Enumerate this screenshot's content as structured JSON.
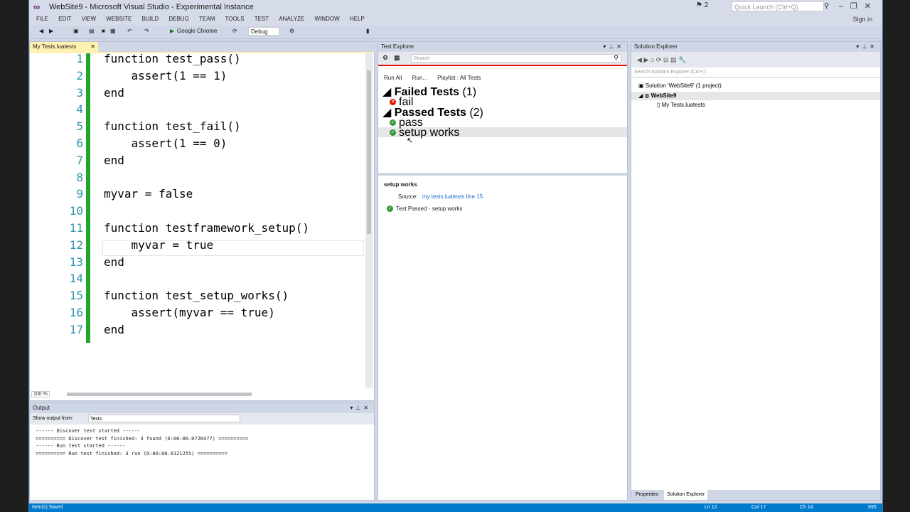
{
  "window": {
    "title": "WebSite9 - Microsoft Visual Studio - Experimental Instance",
    "quick_launch_placeholder": "Quick Launch (Ctrl+Q)",
    "notification_count": "2",
    "sign_in": "Sign in"
  },
  "menu": [
    "FILE",
    "EDIT",
    "VIEW",
    "WEBSITE",
    "BUILD",
    "DEBUG",
    "TEAM",
    "TOOLS",
    "TEST",
    "ANALYZE",
    "WINDOW",
    "HELP"
  ],
  "toolbar": {
    "run_target": "Google Chrome",
    "config": "Debug"
  },
  "editor": {
    "tab": "My Tests.luatests",
    "zoom": "100 %",
    "lines": [
      {
        "n": "1",
        "t": "function test_pass()"
      },
      {
        "n": "2",
        "t": "    assert(1 == 1)"
      },
      {
        "n": "3",
        "t": "end"
      },
      {
        "n": "4",
        "t": ""
      },
      {
        "n": "5",
        "t": "function test_fail()"
      },
      {
        "n": "6",
        "t": "    assert(1 == 0)"
      },
      {
        "n": "7",
        "t": "end"
      },
      {
        "n": "8",
        "t": ""
      },
      {
        "n": "9",
        "t": "myvar = false"
      },
      {
        "n": "10",
        "t": ""
      },
      {
        "n": "11",
        "t": "function testframework_setup()"
      },
      {
        "n": "12",
        "t": "    myvar = true"
      },
      {
        "n": "13",
        "t": "end"
      },
      {
        "n": "14",
        "t": ""
      },
      {
        "n": "15",
        "t": "function test_setup_works()"
      },
      {
        "n": "16",
        "t": "    assert(myvar == true)"
      },
      {
        "n": "17",
        "t": "end"
      }
    ]
  },
  "output": {
    "title": "Output",
    "source_label": "Show output from:",
    "source_value": "Tests",
    "lines": [
      "------ Discover test started ------",
      "========== Discover test finished: 3 found (0:00:00.0726477) ==========",
      "------ Run test started ------",
      "========== Run test finished: 3 run (0:00:00.0121255) =========="
    ]
  },
  "test_explorer": {
    "title": "Test Explorer",
    "search_placeholder": "Search",
    "run_all": "Run All",
    "run": "Run...",
    "playlist": "Playlist : All Tests",
    "failed_header": "Failed Tests",
    "failed_count": "(1)",
    "failed_items": [
      "fail"
    ],
    "passed_header": "Passed Tests",
    "passed_count": "(2)",
    "passed_items": [
      "pass",
      "setup works"
    ],
    "detail": {
      "name": "setup works",
      "source_label": "Source:",
      "source_link": "my tests.luatests line 15",
      "result": "Test Passed - setup works"
    }
  },
  "solution_explorer": {
    "title": "Solution Explorer",
    "search_placeholder": "Search Solution Explorer (Ctrl+;)",
    "solution": "Solution 'WebSite9' (1 project)",
    "project": "WebSite9",
    "file": "My Tests.luatests",
    "tabs": [
      "Properties",
      "Solution Explorer"
    ]
  },
  "status": {
    "message": "Item(s) Saved",
    "ln": "Ln 12",
    "col": "Col 17",
    "ch": "Ch 14",
    "mode": "INS"
  },
  "colors": {
    "accent": "#007acc",
    "pass": "#339933",
    "fail": "#e51400",
    "line_number": "#2b91af"
  }
}
